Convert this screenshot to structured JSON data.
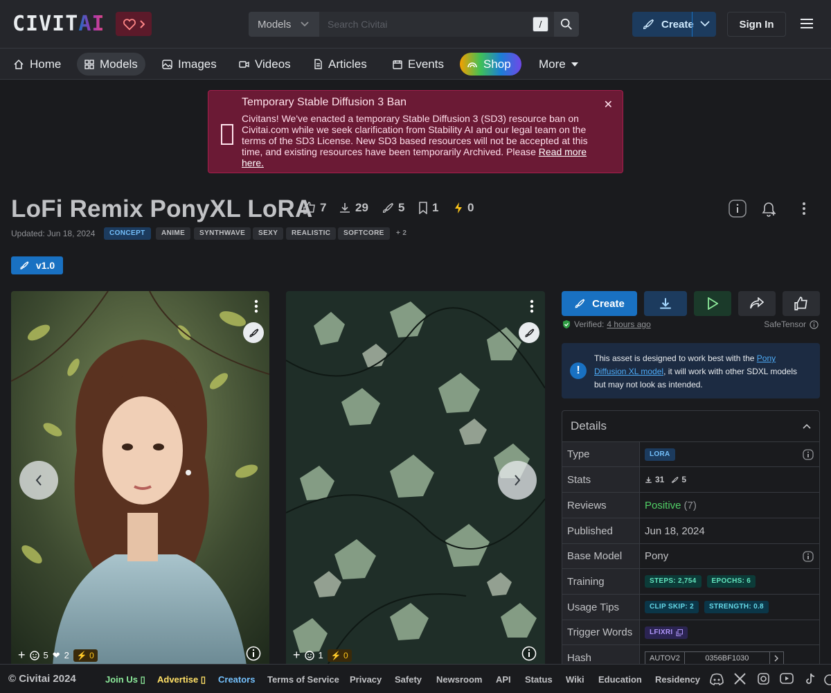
{
  "header": {
    "logo_main": "CIVIT",
    "logo_accent": "AI",
    "search_select": "Models",
    "search_placeholder": "Search Civitai",
    "search_shortcut": "/",
    "create_label": "Create",
    "signin_label": "Sign In"
  },
  "nav": {
    "items": [
      {
        "label": "Home",
        "icon": "home-icon"
      },
      {
        "label": "Models",
        "icon": "grid-icon"
      },
      {
        "label": "Images",
        "icon": "photo-icon"
      },
      {
        "label": "Videos",
        "icon": "video-icon"
      },
      {
        "label": "Articles",
        "icon": "file-icon"
      },
      {
        "label": "Events",
        "icon": "calendar-icon"
      },
      {
        "label": "Shop",
        "icon": "rainbow-icon"
      },
      {
        "label": "More",
        "icon": "caret-down-icon"
      }
    ]
  },
  "alert": {
    "title": "Temporary Stable Diffusion 3 Ban",
    "body": "Civitans! We've enacted a temporary Stable Diffusion 3 (SD3) resource ban on Civitai.com while we seek clarification from Stability AI and our legal team on the terms of the SD3 License. New SD3 based resources will not be accepted at this time, and existing resources have been temporarily Archived. Please ",
    "link": "Read more here."
  },
  "model": {
    "title": "LoFi Remix PonyXL LoRA",
    "stats": {
      "likes": "7",
      "downloads": "29",
      "generations": "5",
      "bookmarks": "1",
      "buzz": "0"
    },
    "updated": "Updated: Jun 18, 2024",
    "tags": [
      "CONCEPT",
      "ANIME",
      "SYNTHWAVE",
      "SEXY",
      "REALISTIC",
      "SOFTCORE",
      "+ 2"
    ],
    "version": "v1.0"
  },
  "gallery": [
    {
      "comments": "5",
      "hearts": "2",
      "buzz": "0"
    },
    {
      "comments": "1",
      "buzz": "0"
    }
  ],
  "actions": {
    "create_label": "Create",
    "verified_label": "Verified:",
    "verified_time": "4 hours ago",
    "file_format": "SafeTensor"
  },
  "notice": {
    "pre": "This asset is designed to work best with the ",
    "link": "Pony Diffusion XL model",
    "post": ", it will work with other SDXL models but may not look as intended."
  },
  "details": {
    "heading": "Details",
    "rows": {
      "type": {
        "k": "Type",
        "v": "LORA"
      },
      "stats": {
        "k": "Stats",
        "downloads": "31",
        "generations": "5"
      },
      "reviews": {
        "k": "Reviews",
        "v": "Positive",
        "count": "(7)"
      },
      "published": {
        "k": "Published",
        "v": "Jun 18, 2024"
      },
      "base": {
        "k": "Base Model",
        "v": "Pony"
      },
      "training": {
        "k": "Training",
        "steps": "STEPS: 2,754",
        "epochs": "EPOCHS: 6"
      },
      "usage": {
        "k": "Usage Tips",
        "clip": "CLIP SKIP: 2",
        "strength": "STRENGTH: 0.8"
      },
      "trigger": {
        "k": "Trigger Words",
        "v": "LFIXRI"
      },
      "hash": {
        "k": "Hash",
        "algo": "AUTOV2",
        "v": "0356BF1030"
      }
    }
  },
  "footer": {
    "copyright": "© Civitai 2024",
    "links": [
      "Join Us",
      "Advertise",
      "Creators",
      "Terms of Service",
      "Privacy",
      "Safety",
      "Newsroom",
      "API",
      "Status",
      "Wiki",
      "Education",
      "Residency"
    ],
    "colors": {
      "join": "#8ce99a",
      "advertise": "#ffe066",
      "creators": "#74c0fc"
    }
  }
}
